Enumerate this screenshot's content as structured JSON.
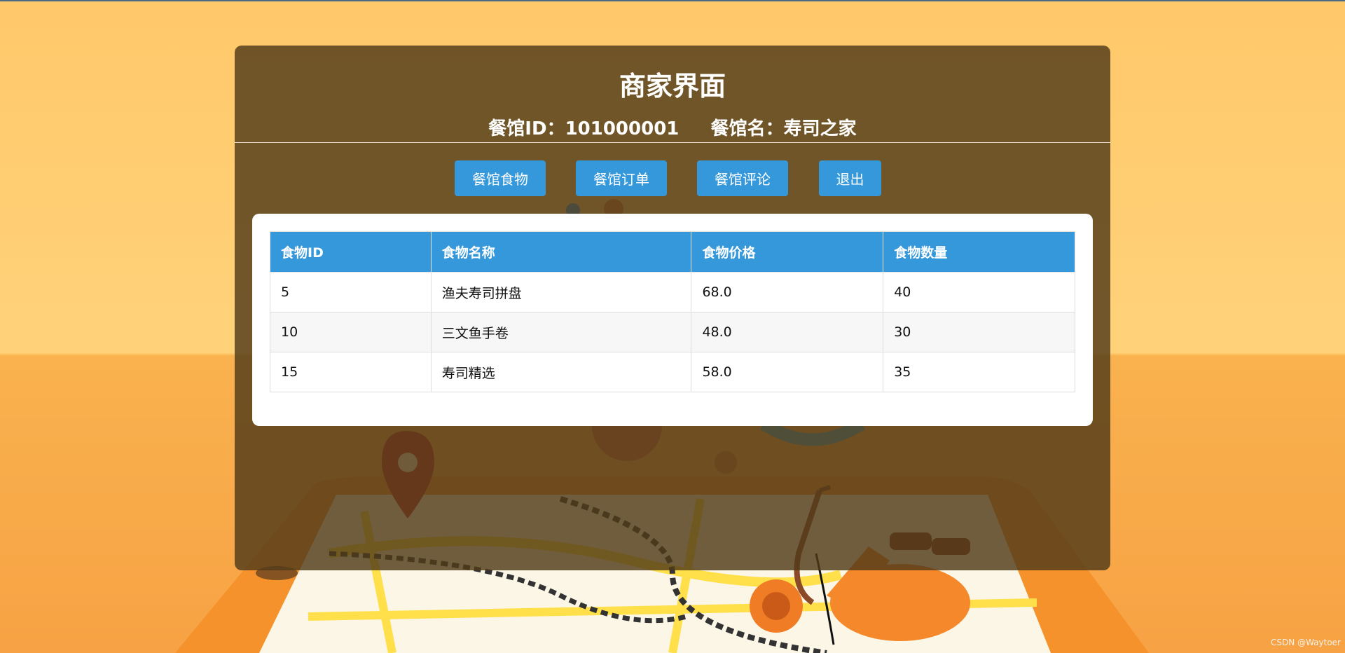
{
  "page": {
    "title": "商家界面",
    "restaurant_id_label": "餐馆ID：",
    "restaurant_id": "101000001",
    "restaurant_name_label": "餐馆名：",
    "restaurant_name": "寿司之家"
  },
  "nav": {
    "food": "餐馆食物",
    "orders": "餐馆订单",
    "reviews": "餐馆评论",
    "logout": "退出"
  },
  "table": {
    "headers": [
      "食物ID",
      "食物名称",
      "食物价格",
      "食物数量"
    ],
    "rows": [
      [
        "5",
        "渔夫寿司拼盘",
        "68.0",
        "40"
      ],
      [
        "10",
        "三文鱼手卷",
        "48.0",
        "30"
      ],
      [
        "15",
        "寿司精选",
        "58.0",
        "35"
      ]
    ]
  },
  "watermark": "CSDN @Waytoer",
  "colors": {
    "accent": "#3498db",
    "panel": "#503a19",
    "background": "#ffc86a"
  }
}
